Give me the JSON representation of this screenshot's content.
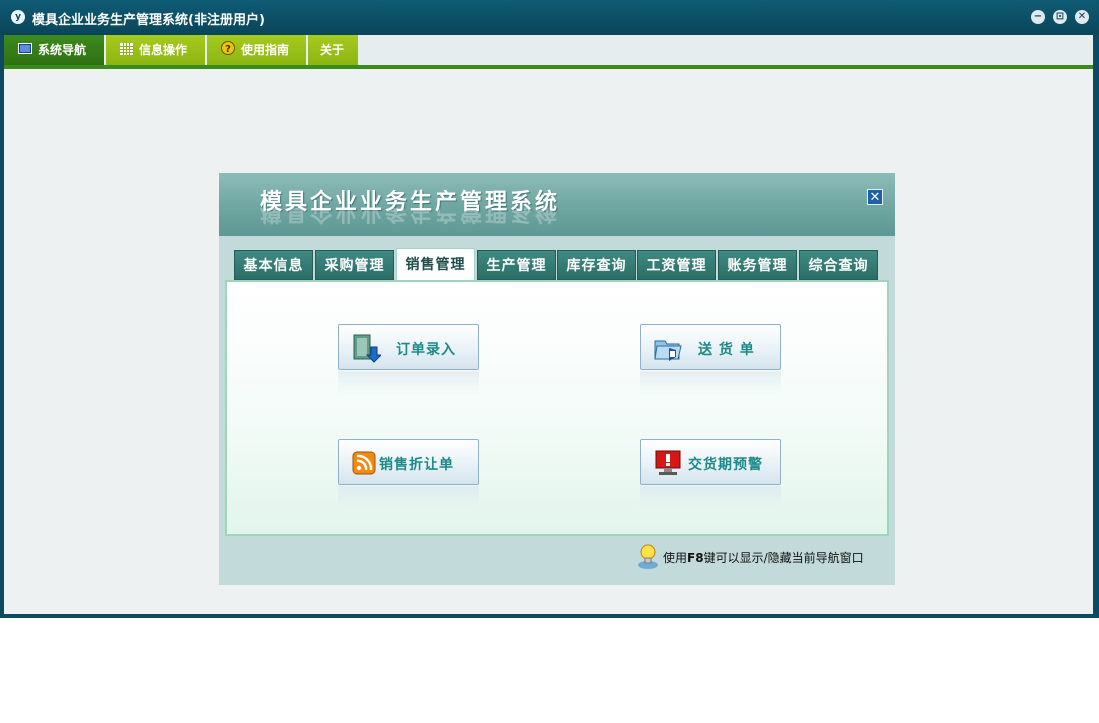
{
  "window": {
    "title": "模具企业业务生产管理系统(非注册用户)",
    "app_icon_glyph": "y",
    "controls": {
      "minimize": "−",
      "restore": "⊡",
      "close": "✕"
    }
  },
  "menu": {
    "items": [
      {
        "label": "系统导航",
        "icon": "monitor-icon"
      },
      {
        "label": "信息操作",
        "icon": "grid-icon"
      },
      {
        "label": "使用指南",
        "icon": "help-icon"
      },
      {
        "label": "关于",
        "icon": ""
      }
    ]
  },
  "panel": {
    "title": "模具企业业务生产管理系统",
    "close_glyph": "✕",
    "tabs": [
      {
        "label": "基本信息",
        "active": false
      },
      {
        "label": "采购管理",
        "active": false
      },
      {
        "label": "销售管理",
        "active": true
      },
      {
        "label": "生产管理",
        "active": false
      },
      {
        "label": "库存查询",
        "active": false
      },
      {
        "label": "工资管理",
        "active": false
      },
      {
        "label": "账务管理",
        "active": false
      },
      {
        "label": "综合查询",
        "active": false
      }
    ],
    "actions": [
      {
        "label": "订单录入",
        "icon": "order-entry-icon"
      },
      {
        "label": "送 货 单",
        "icon": "delivery-note-icon"
      },
      {
        "label": "销售折让单",
        "icon": "rss-discount-icon"
      },
      {
        "label": "交货期预警",
        "icon": "alert-monitor-icon"
      }
    ],
    "hint": {
      "prefix": "使用",
      "key": "F8",
      "suffix": "键可以显示/隐藏当前导航窗口"
    }
  },
  "colors": {
    "titlebar": "#0b4a60",
    "menu_active": "#2f7112",
    "menu_item": "#8cb412",
    "panel_header": "#6fa6a2",
    "tab": "#2b6e67",
    "action_text": "#1d8a88"
  }
}
